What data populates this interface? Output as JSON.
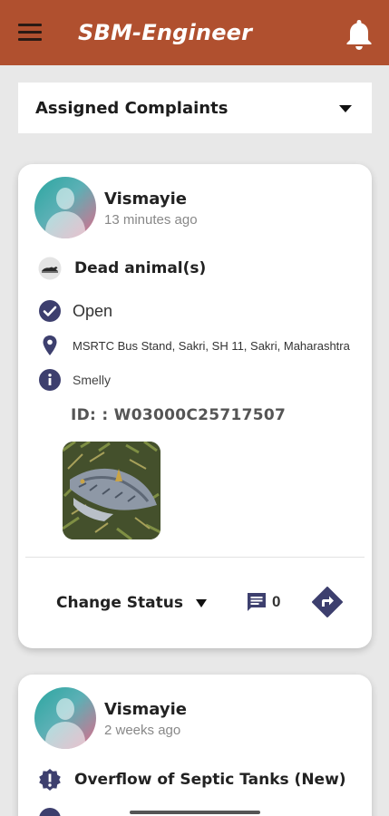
{
  "app": {
    "title": "SBM-Engineer"
  },
  "filter": {
    "selected": "Assigned Complaints"
  },
  "complaints": [
    {
      "user": "Vismayie",
      "time": "13 minutes ago",
      "category": "Dead animal(s)",
      "status": "Open",
      "address": "MSRTC Bus Stand,  Sakri,  SH 11,  Sakri,  Maharashtra",
      "description": "Smelly",
      "id": "ID: : W03000C25717507",
      "change_status_label": "Change Status",
      "comment_count": "0"
    },
    {
      "user": "Vismayie",
      "time": "2 weeks ago",
      "category": "Overflow of Septic Tanks (New)"
    }
  ],
  "colors": {
    "appbar": "#b0502f",
    "icon_navy": "#3d3f6e",
    "background": "#e8e8e8"
  },
  "icons": [
    "menu-icon",
    "bell-icon",
    "dropdown-arrow-icon",
    "dead-animal-icon",
    "check-circle-icon",
    "location-pin-icon",
    "info-icon",
    "comment-icon",
    "directions-icon",
    "alert-badge-icon"
  ]
}
